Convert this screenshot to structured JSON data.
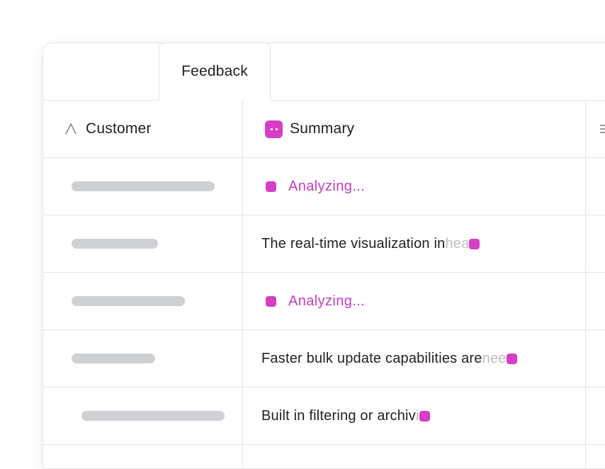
{
  "tabs": [
    {
      "label": "Feedback",
      "active": true
    }
  ],
  "columns": {
    "customer": {
      "label": "Customer",
      "icon": "text-type-icon"
    },
    "summary": {
      "label": "Summary",
      "icon": "ai-summary-icon"
    },
    "extra": {
      "icon": "text-align-icon"
    }
  },
  "accent_color": "#d63ec6",
  "rows": [
    {
      "customer_placeholder": true,
      "summary_status": "Analyzing...",
      "summary_text": null
    },
    {
      "customer_placeholder": true,
      "summary_status": null,
      "summary_text": "The real-time visualization in ",
      "summary_fade": "hea"
    },
    {
      "customer_placeholder": true,
      "summary_status": "Analyzing...",
      "summary_text": null
    },
    {
      "customer_placeholder": true,
      "summary_status": null,
      "summary_text": "Faster bulk update capabilities are ",
      "summary_fade": "nee"
    },
    {
      "customer_placeholder": true,
      "summary_status": null,
      "summary_text": "Built in filtering or archiv",
      "summary_fade": "i"
    }
  ]
}
